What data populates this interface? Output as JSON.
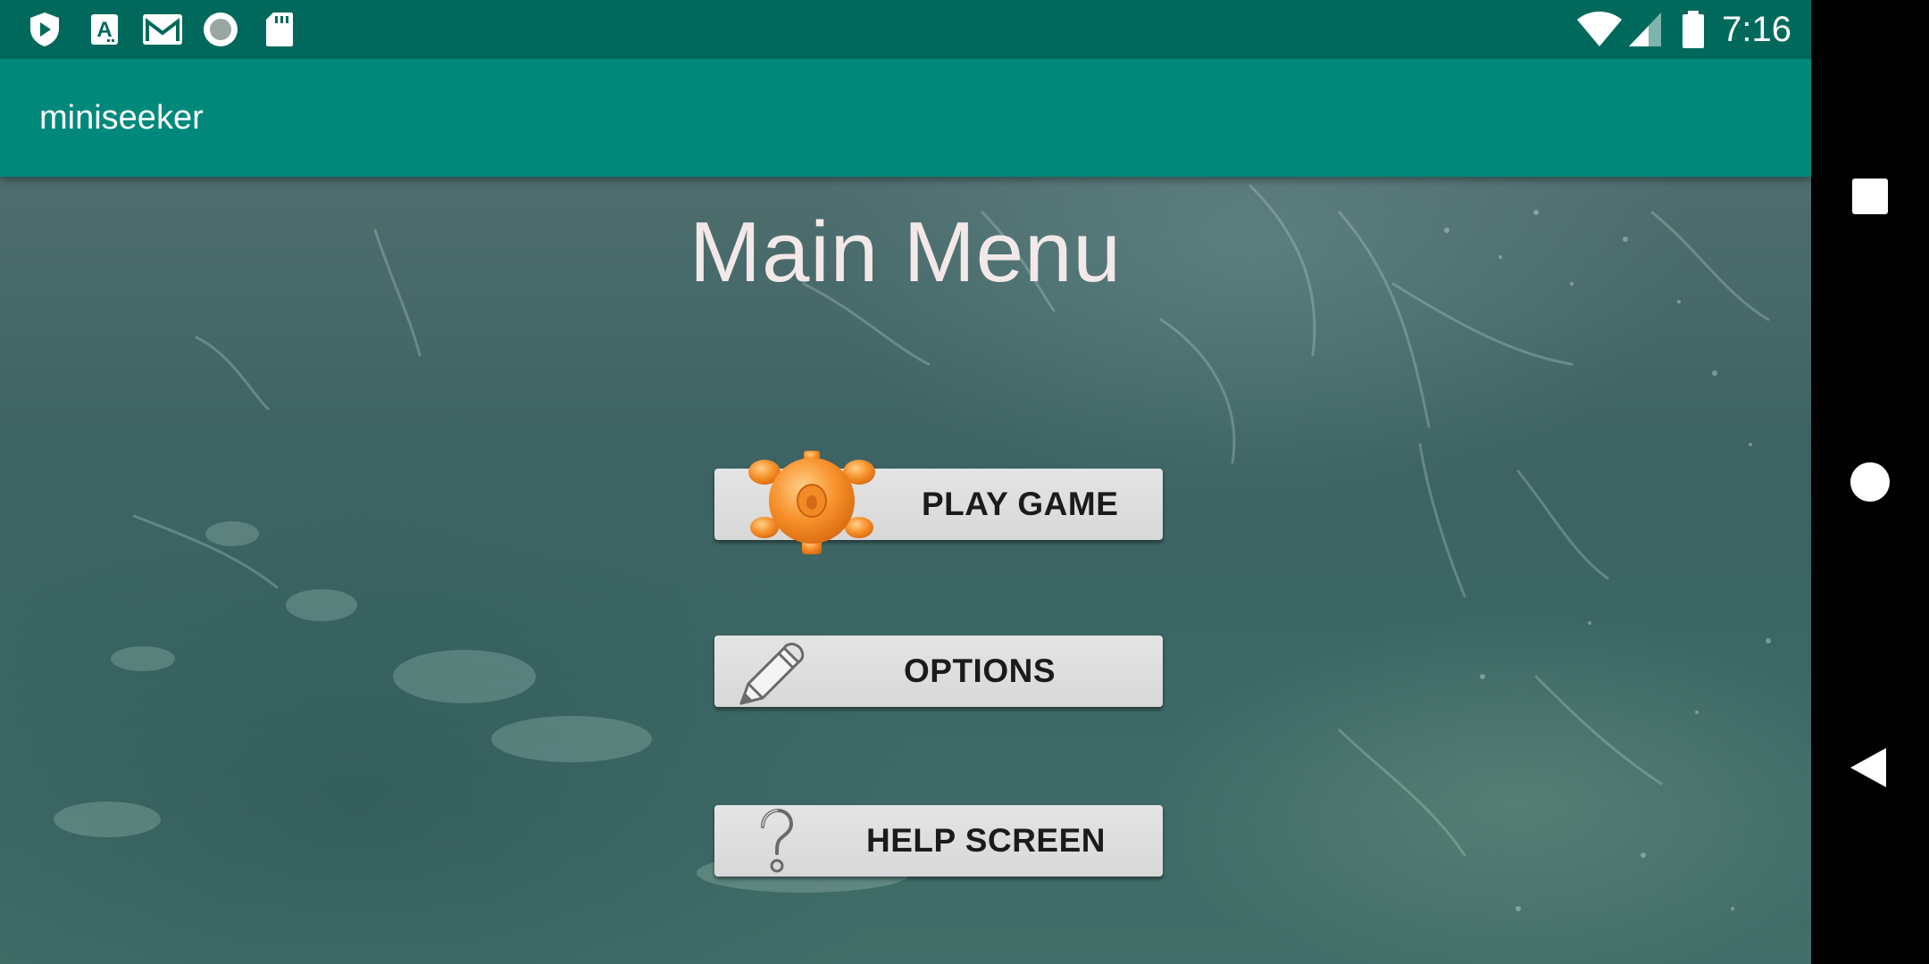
{
  "status_bar": {
    "time": "7:16",
    "icons": [
      "play-protect-icon",
      "font-a-icon",
      "gmail-icon",
      "circle-app-icon",
      "sd-card-icon",
      "wifi-icon",
      "signal-icon",
      "battery-icon"
    ],
    "background": "#00695c"
  },
  "app_bar": {
    "title": "miniseeker",
    "background": "#00897b"
  },
  "main": {
    "title": "Main Menu",
    "buttons": [
      {
        "label": "PLAY GAME",
        "icon": "sea-mine-icon"
      },
      {
        "label": "OPTIONS",
        "icon": "pencil-icon"
      },
      {
        "label": "HELP SCREEN",
        "icon": "question-mark-icon"
      }
    ]
  },
  "navigation_bar": {
    "buttons": [
      "recents-icon",
      "home-icon",
      "back-icon"
    ]
  },
  "colors": {
    "title_text": "#f3e8e8",
    "button_bg": "#dcdcdc",
    "mine_orange": "#f7902a"
  }
}
